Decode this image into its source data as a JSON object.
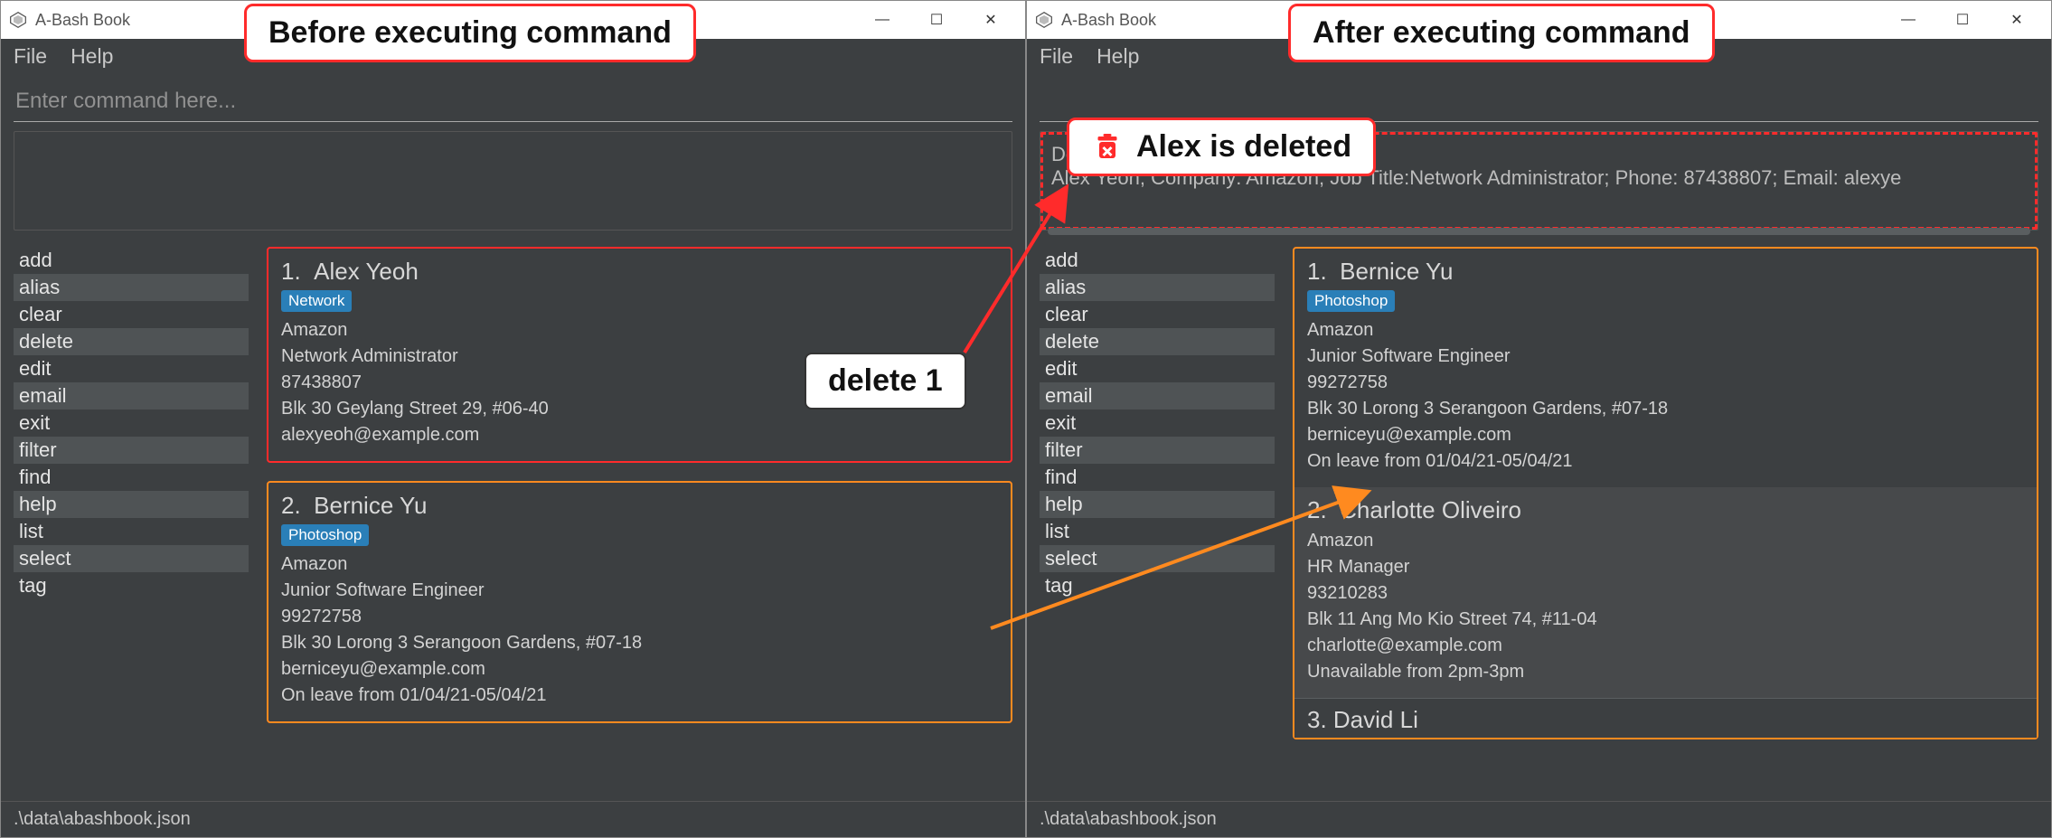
{
  "annotations": {
    "before_label": "Before executing command",
    "after_label": "After executing command",
    "deleted_label": "Alex is deleted",
    "cmd_label": "delete 1"
  },
  "left": {
    "title": "A-Bash Book",
    "menu": {
      "file": "File",
      "help": "Help"
    },
    "cmd_placeholder": "Enter command here...",
    "output": "",
    "sidebar": [
      "add",
      "alias",
      "clear",
      "delete",
      "edit",
      "email",
      "exit",
      "filter",
      "find",
      "help",
      "list",
      "select",
      "tag"
    ],
    "cards": [
      {
        "idx": "1.",
        "name": "Alex Yeoh",
        "tag": "Network",
        "company": "Amazon",
        "job": "Network Administrator",
        "phone": "87438807",
        "addr": "Blk 30 Geylang Street 29, #06-40",
        "email": "alexyeoh@example.com"
      },
      {
        "idx": "2.",
        "name": "Bernice Yu",
        "tag": "Photoshop",
        "company": "Amazon",
        "job": "Junior Software Engineer",
        "phone": "99272758",
        "addr": "Blk 30 Lorong 3 Serangoon Gardens, #07-18",
        "email": "berniceyu@example.com",
        "note": "On leave from 01/04/21-05/04/21"
      }
    ],
    "status": ".\\data\\abashbook.json"
  },
  "right": {
    "title": "A-Bash Book",
    "menu": {
      "file": "File",
      "help": "Help"
    },
    "output_l1": "Deleted person:",
    "output_l2": "Alex Yeoh; Company: Amazon; Job Title:Network Administrator; Phone: 87438807; Email: alexye",
    "sidebar": [
      "add",
      "alias",
      "clear",
      "delete",
      "edit",
      "email",
      "exit",
      "filter",
      "find",
      "help",
      "list",
      "select",
      "tag"
    ],
    "cards": [
      {
        "idx": "1.",
        "name": "Bernice Yu",
        "tag": "Photoshop",
        "company": "Amazon",
        "job": "Junior Software Engineer",
        "phone": "99272758",
        "addr": "Blk 30 Lorong 3 Serangoon Gardens, #07-18",
        "email": "berniceyu@example.com",
        "note": "On leave from 01/04/21-05/04/21"
      },
      {
        "idx": "2.",
        "name": "Charlotte Oliveiro",
        "company": "Amazon",
        "job": "HR Manager",
        "phone": "93210283",
        "addr": "Blk 11 Ang Mo Kio Street 74, #11-04",
        "email": "charlotte@example.com",
        "note": "Unavailable from 2pm-3pm"
      }
    ],
    "next": "3.  David Li",
    "status": ".\\data\\abashbook.json"
  }
}
